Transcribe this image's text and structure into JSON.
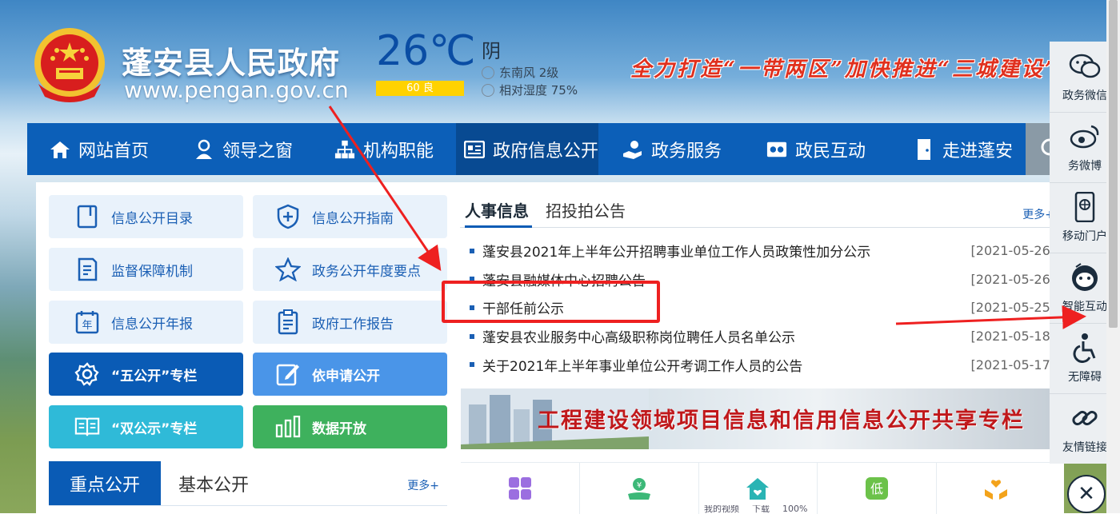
{
  "header": {
    "site_title": "蓬安县人民政府",
    "site_url": "www.pengan.gov.cn",
    "weather": {
      "temperature": "26℃",
      "aqi": "60 良",
      "condition": "阴",
      "wind": "东南风 2级",
      "humidity": "相对湿度 75%"
    },
    "slogan": "全力打造“一带两区”加快推进“三城建设”"
  },
  "nav": {
    "items": [
      {
        "label": "网站首页",
        "icon": "home-icon"
      },
      {
        "label": "领导之窗",
        "icon": "leader-icon"
      },
      {
        "label": "机构职能",
        "icon": "org-chart-icon"
      },
      {
        "label": "政府信息公开",
        "icon": "info-card-icon",
        "active": true
      },
      {
        "label": "政务服务",
        "icon": "service-hand-icon"
      },
      {
        "label": "政民互动",
        "icon": "interaction-icon"
      },
      {
        "label": "走进蓬安",
        "icon": "door-icon"
      }
    ],
    "search_icon": "search-icon"
  },
  "tiles": [
    {
      "label": "信息公开目录",
      "icon": "catalog-icon"
    },
    {
      "label": "信息公开指南",
      "icon": "shield-plus-icon"
    },
    {
      "label": "监督保障机制",
      "icon": "document-icon"
    },
    {
      "label": "政务公开年度要点",
      "icon": "star-icon"
    },
    {
      "label": "信息公开年报",
      "icon": "calendar-year-icon"
    },
    {
      "label": "政府工作报告",
      "icon": "clipboard-icon"
    },
    {
      "label": "“五公开”专栏",
      "icon": "gear-icon"
    },
    {
      "label": "依申请公开",
      "icon": "edit-icon"
    },
    {
      "label": "“双公示”专栏",
      "icon": "book-icon"
    },
    {
      "label": "数据开放",
      "icon": "bar-chart-icon"
    }
  ],
  "key_tabs": {
    "active": "重点公开",
    "other": "基本公开",
    "more": "更多+"
  },
  "news": {
    "tabs": [
      "人事信息",
      "招投拍公告"
    ],
    "more": "更多+",
    "items": [
      {
        "title": "蓬安县2021年上半年公开招聘事业单位工作人员政策性加分公示",
        "date": "[2021-05-26]"
      },
      {
        "title": "蓬安县融媒体中心招聘公告",
        "date": "[2021-05-26]"
      },
      {
        "title": "干部任前公示",
        "date": "[2021-05-25]"
      },
      {
        "title": "蓬安县农业服务中心高级职称岗位聘任人员名单公示",
        "date": "[2021-05-18]"
      },
      {
        "title": "关于2021年上半年事业单位公开考调工作人员的公告",
        "date": "[2021-05-17]"
      }
    ]
  },
  "banner": {
    "text": "工程建设领域项目信息和信用信息公开共享专栏"
  },
  "quick_icons": [
    {
      "icon": "grid-icon",
      "color": "#9b6ee0"
    },
    {
      "icon": "money-hand-icon",
      "color": "#3cb878"
    },
    {
      "icon": "house-heart-icon",
      "color": "#2ab4b4"
    },
    {
      "icon": "low-income-icon",
      "color": "#6cc24a",
      "text": "低"
    },
    {
      "icon": "care-hands-icon",
      "color": "#f3a31b"
    }
  ],
  "sidebar": {
    "items": [
      {
        "label": "政务微信",
        "icon": "wechat-icon"
      },
      {
        "label": "务微博",
        "icon": "weibo-icon"
      },
      {
        "label": "移动门户",
        "icon": "mobile-portal-icon"
      },
      {
        "label": "智能互动",
        "icon": "robot-icon"
      },
      {
        "label": "无障碍",
        "icon": "accessibility-icon"
      },
      {
        "label": "友情链接",
        "icon": "link-icon"
      }
    ],
    "close_icon": "close-icon"
  },
  "status_bar": [
    "我的视频",
    "下载",
    "100%"
  ],
  "colors": {
    "nav_blue": "#0c5fb8",
    "nav_active": "#084a92",
    "annotation_red": "#ee2020",
    "slogan_red": "#e0301e"
  }
}
